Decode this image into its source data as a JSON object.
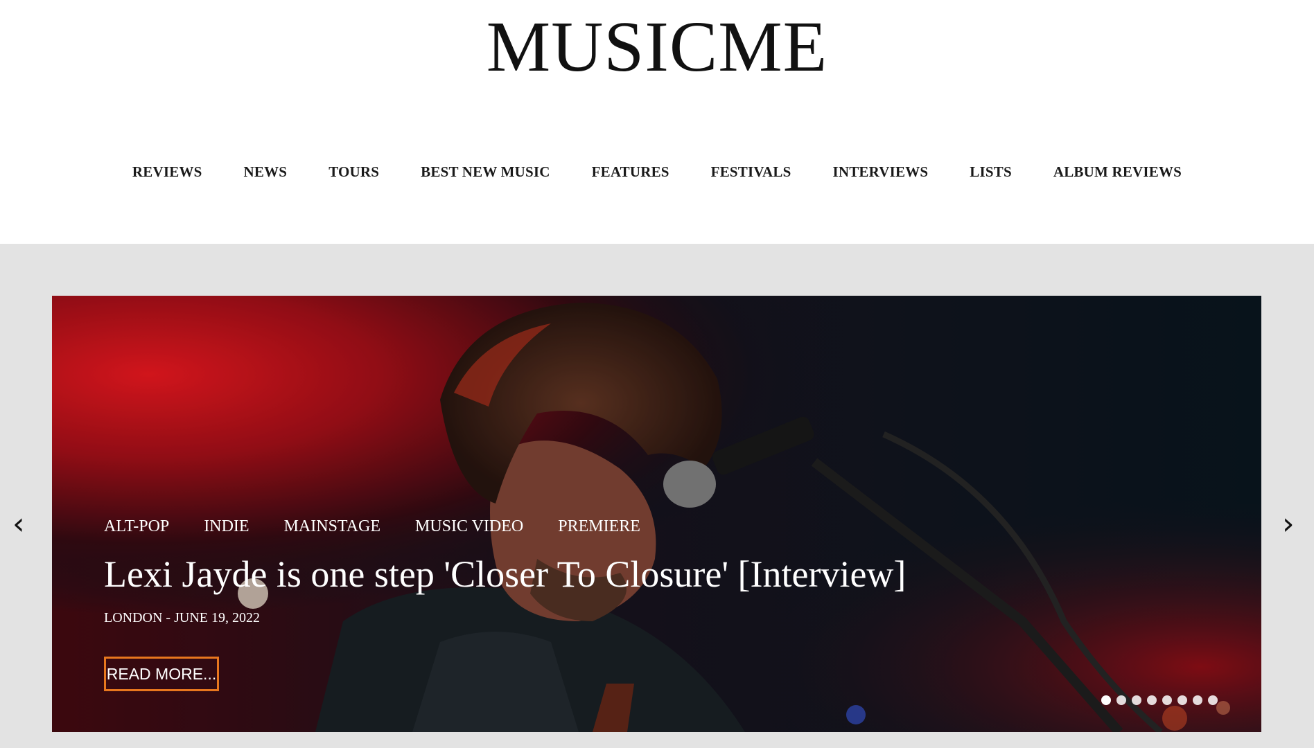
{
  "site": {
    "logo": "MUSICME"
  },
  "nav": {
    "items": [
      {
        "label": "REVIEWS"
      },
      {
        "label": "NEWS"
      },
      {
        "label": "TOURS"
      },
      {
        "label": "BEST NEW MUSIC"
      },
      {
        "label": "FEATURES"
      },
      {
        "label": "FESTIVALS"
      },
      {
        "label": "INTERVIEWS"
      },
      {
        "label": "LISTS"
      },
      {
        "label": "ALBUM REVIEWS"
      }
    ]
  },
  "slider": {
    "prev_icon": "‹",
    "next_icon": "›",
    "slide": {
      "tags": [
        "ALT-POP",
        "INDIE",
        "MAINSTAGE",
        "MUSIC VIDEO",
        "PREMIERE"
      ],
      "headline": "Lexi Jayde is one step 'Closer To Closure' [Interview]",
      "meta": "LONDON - JUNE 19, 2022",
      "cta": "READ MORE..."
    },
    "dots_count": 8,
    "active_dot": 0
  },
  "colors": {
    "accent": "#e8771e",
    "page_bg": "#e3e3e3",
    "header_bg": "#ffffff",
    "nav_text": "#1a1a1a"
  }
}
